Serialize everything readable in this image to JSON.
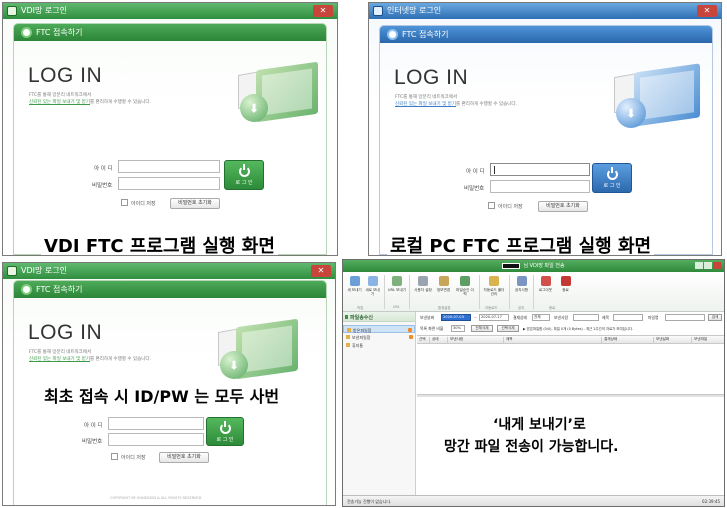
{
  "colors": {
    "green_accent": "#2f8f3e",
    "blue_accent": "#2e6fb4",
    "close_red": "#c8453b",
    "date_highlight": "#2f6fd1"
  },
  "vdi": {
    "window_title": "VDI망 로그인",
    "panel_title": "FTC 접속하기",
    "heading": "LOG IN",
    "desc_line1": "FTC를 통해 망분리 네트워크에서",
    "desc_highlight": "신뢰된 있는 파일 보내기 및 받기",
    "desc_rest": "를 편리하게 수행할 수 있습니다.",
    "id_label": "아 이 디",
    "pw_label": "비밀번호",
    "login_button": "로 그 인",
    "save_id_label": "아이디 저장",
    "reset_pw_button": "비밀번호 초기화",
    "caption": "VDI FTC 프로그램 실행 화면"
  },
  "local": {
    "window_title": "인터넷망 로그인",
    "panel_title": "FTC 접속하기",
    "heading": "LOG IN",
    "desc_line1": "FTC를 통해 망분리 네트워크에서",
    "desc_highlight": "신뢰된 있는 파일 보내기 및 받기",
    "desc_rest": "를 편리하게 수행할 수 있습니다.",
    "id_label": "아 이 디",
    "pw_label": "비밀번호",
    "login_button": "로 그 인",
    "save_id_label": "아이디 저장",
    "reset_pw_button": "비밀번호 초기화",
    "caption": "로컬 PC FTC 프로그램 실행 화면"
  },
  "first": {
    "window_title": "VDI망 로그인",
    "panel_title": "FTC 접속하기",
    "heading": "LOG IN",
    "desc_line1": "FTC를 통해 망분리 네트워크에서",
    "desc_highlight": "신뢰된 있는 파일 보내기 및 받기",
    "desc_rest": "를 편리하게 수행할 수 있습니다.",
    "id_label": "아 이 디",
    "pw_label": "비밀번호",
    "login_button": "로 그 인",
    "save_id_label": "아이디 저장",
    "reset_pw_button": "비밀번호 초기화",
    "copyright": "COPYRIGHT BY HUNEDION & ALL RIGHTS RESERVED",
    "caption": "최초 접속 시 ID/PW 는 모두 사번"
  },
  "filetransfer": {
    "window_title": "님 VDI망 파일 전송",
    "ribbon": {
      "buttons": [
        "새 보내기",
        "새로 보내기",
        "URL 보내기",
        "사용자 설정",
        "정보변경",
        "파일승인 이력",
        "자동로드 폴더 관리",
        "공지사항",
        "로그아웃",
        "종료"
      ],
      "groups": [
        "작업",
        "URL",
        "환경설정",
        "자동로드",
        "공지",
        "종료"
      ]
    },
    "sidebar": {
      "title": "파일송수신",
      "items": [
        "받은파일함",
        "보낸파일함",
        "휴지통"
      ]
    },
    "filter": {
      "date_label": "보낸날짜",
      "date_from": "2020-07-03",
      "date_sep": "~",
      "date_to": "2020-07-17",
      "result_label": "결재상태",
      "result_value": "전체",
      "sender_label": "보낸사람",
      "subject_label": "제목",
      "filename_label": "파일명",
      "search_button": "검색",
      "display_label": "목록 화면 비율",
      "display_value": "30%",
      "select_all_button": "전체삭제",
      "select_delete_button": "선택삭제",
      "summary": "▶ 받은파일함 (0/0), 파일 0개 (0 Bytes) - 최근 2주간의 자료가 보여집니다."
    },
    "columns": [
      "선택",
      "상태",
      "보낸사람",
      "제목",
      "결재상태",
      "보낸날짜",
      "보낸파일"
    ],
    "status_left": "전송가능 진행이 없습니다.",
    "status_right": "02:39:45",
    "caption_line1": "‘내게 보내기’로",
    "caption_line2": "망간 파일 전송이 가능합니다."
  }
}
